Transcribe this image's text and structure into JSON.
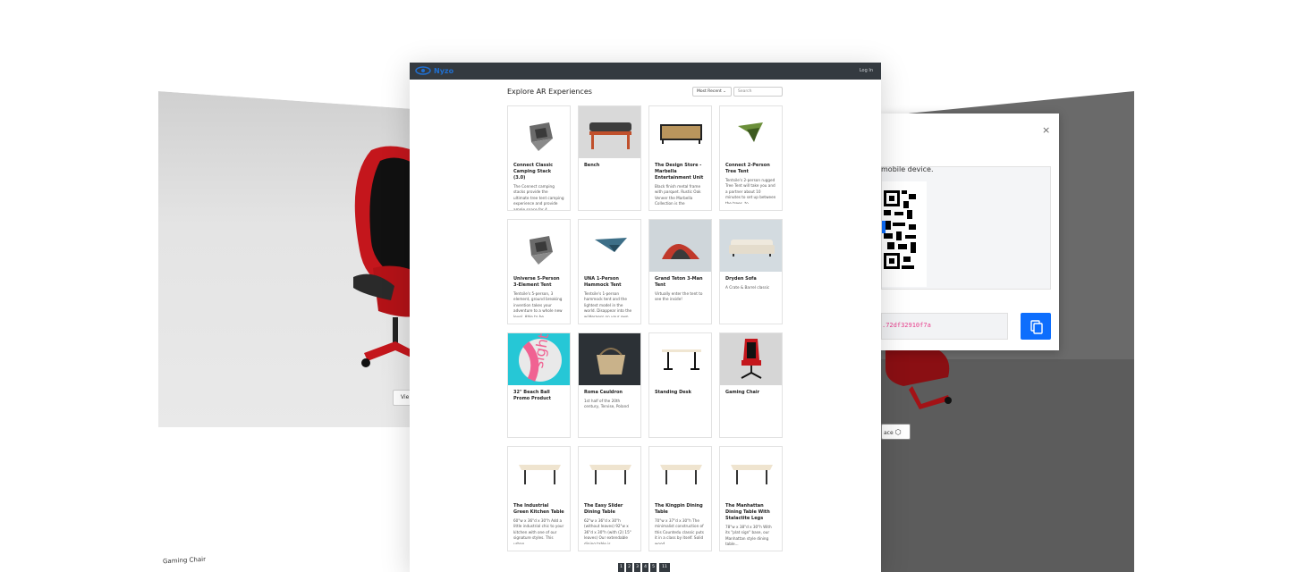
{
  "app": {
    "logo_text": "Nyzo",
    "login_label": "Log In"
  },
  "page": {
    "title": "Explore AR Experiences"
  },
  "controls": {
    "sort_selected": "Most Recent",
    "search_placeholder": "Search"
  },
  "cards": [
    {
      "title": "Connect Classic Camping Stack (3.0)",
      "desc": "The Connect camping stacks provide the ultimate tree tent camping experience and provide ample space for 4...",
      "thumb": "tent-icon",
      "bg": "#ffffff"
    },
    {
      "title": "Bench",
      "desc": "",
      "thumb": "bench-icon",
      "bg": "#d9d9d9"
    },
    {
      "title": "The Design Store - Marbella Entertainment Unit",
      "desc": "Black finish metal frame with parquet. Rustic Oak Veneer the Marbella Collection is the",
      "thumb": "cabinet-icon",
      "bg": "#ffffff"
    },
    {
      "title": "Connect 2-Person Tree Tent",
      "desc": "Tentsile's 2-person rugged Tree Tent will take you and a partner about 10 minutes to set up between the trees, to...",
      "thumb": "tree-tent-icon",
      "bg": "#ffffff"
    },
    {
      "title": "Universe 5-Person 3-Element Tent",
      "desc": "Tentsile's 5-person, 3 element, ground breaking invention takes your adventure to a whole new level. Able to be...",
      "thumb": "tent-icon",
      "bg": "#ffffff"
    },
    {
      "title": "UNA 1-Person Hammock Tent",
      "desc": "Tentsile's 1-person hammock tent and the lightest model in the world. Disappear into the wilderness on your own for...",
      "thumb": "hammock-icon",
      "bg": "#ffffff"
    },
    {
      "title": "Grand Teton 3-Man Tent",
      "desc": "Virtually enter the tent to see the inside!",
      "thumb": "dome-tent-icon",
      "bg": "#cfd6da"
    },
    {
      "title": "Dryden Sofa",
      "desc": "A Crate & Barrel classic",
      "thumb": "sofa-icon",
      "bg": "#d3dbe0"
    },
    {
      "title": "32\" Beach Ball Promo Product",
      "desc": "",
      "thumb": "beach-ball-icon",
      "bg": "#26c7d6"
    },
    {
      "title": "Roma Cauldron",
      "desc": "1st half of the 20th century, Tervise, Poland",
      "thumb": "basket-icon",
      "bg": "#2c3136"
    },
    {
      "title": "Standing Desk",
      "desc": "",
      "thumb": "desk-icon",
      "bg": "#ffffff"
    },
    {
      "title": "Gaming Chair",
      "desc": "",
      "thumb": "gaming-chair-icon",
      "bg": "#d6d6d6"
    },
    {
      "title": "The Industrial Green Kitchen Table",
      "desc": "60\"w x 36\"d x 30\"h Add a little industrial chic to your kitchen with one of our signature styles. This urban...",
      "thumb": "table-icon",
      "bg": "#ffffff"
    },
    {
      "title": "The Easy Slider Dining Table",
      "desc": "62\"w x 36\"d x 30\"h (without leaves) 92\"w x 36\"d x 30\"h (with (2) 15\" leaves) Our extendable dining table is...",
      "thumb": "table-icon",
      "bg": "#ffffff"
    },
    {
      "title": "The Kingpin Dining Table",
      "desc": "70\"w x 37\"d x 30\"h The minimalist construction of this Countedu classic puts it in a class by itself. Solid wood...",
      "thumb": "table-icon",
      "bg": "#ffffff"
    },
    {
      "title": "The Manhattan Dining Table With Stalactite Legs",
      "desc": "78\"w x 38\"d x 30\"h With its \"plat sign\" base, our Manhattan style dining table...",
      "thumb": "table-icon",
      "bg": "#ffffff"
    }
  ],
  "pagination": [
    "1",
    "2",
    "3",
    "4",
    "5",
    "11"
  ],
  "left_panel": {
    "view_label": "Vie",
    "product_label": "Gaming Chair"
  },
  "right_panel": {
    "ar_label": "ace"
  },
  "qr_modal": {
    "instruction": "mobile device.",
    "url_fragment": ".72df32910f7a",
    "close": "×"
  },
  "colors": {
    "navbar": "#343a40",
    "accent": "#0d6efd",
    "chair_red": "#c4161c"
  }
}
